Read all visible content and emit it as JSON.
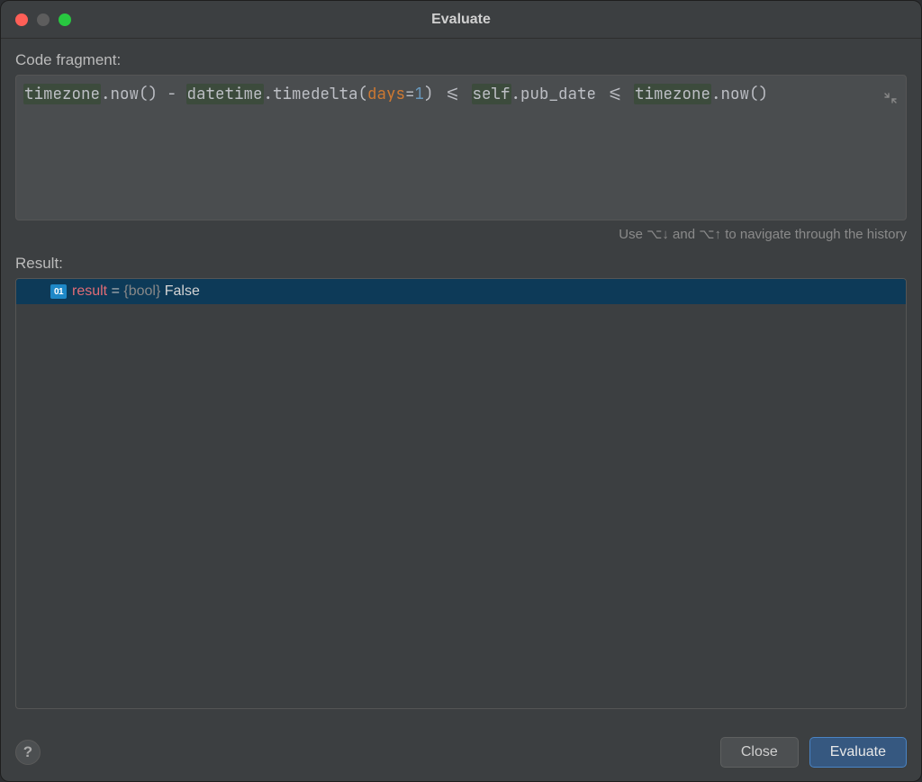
{
  "window": {
    "title": "Evaluate"
  },
  "labels": {
    "codeFragment": "Code fragment:",
    "result": "Result:"
  },
  "code": {
    "segments": [
      {
        "text": "timezone",
        "cls": "hl"
      },
      {
        "text": ".now() - "
      },
      {
        "text": "datetime",
        "cls": "hl"
      },
      {
        "text": ".timedelta("
      },
      {
        "text": "days",
        "cls": "kw"
      },
      {
        "text": "="
      },
      {
        "text": "1",
        "cls": "num"
      },
      {
        "text": ") <= "
      },
      {
        "text": "self",
        "cls": "hl"
      },
      {
        "text": ".pub_date <= "
      },
      {
        "text": "timezone",
        "cls": "hl"
      },
      {
        "text": ".now()"
      }
    ]
  },
  "hint": "Use ⌥↓ and ⌥↑ to navigate through the history",
  "result": {
    "iconText": "01",
    "name": "result",
    "equals": " = ",
    "type": "{bool} ",
    "value": "False"
  },
  "buttons": {
    "help": "?",
    "close": "Close",
    "evaluate": "Evaluate"
  }
}
